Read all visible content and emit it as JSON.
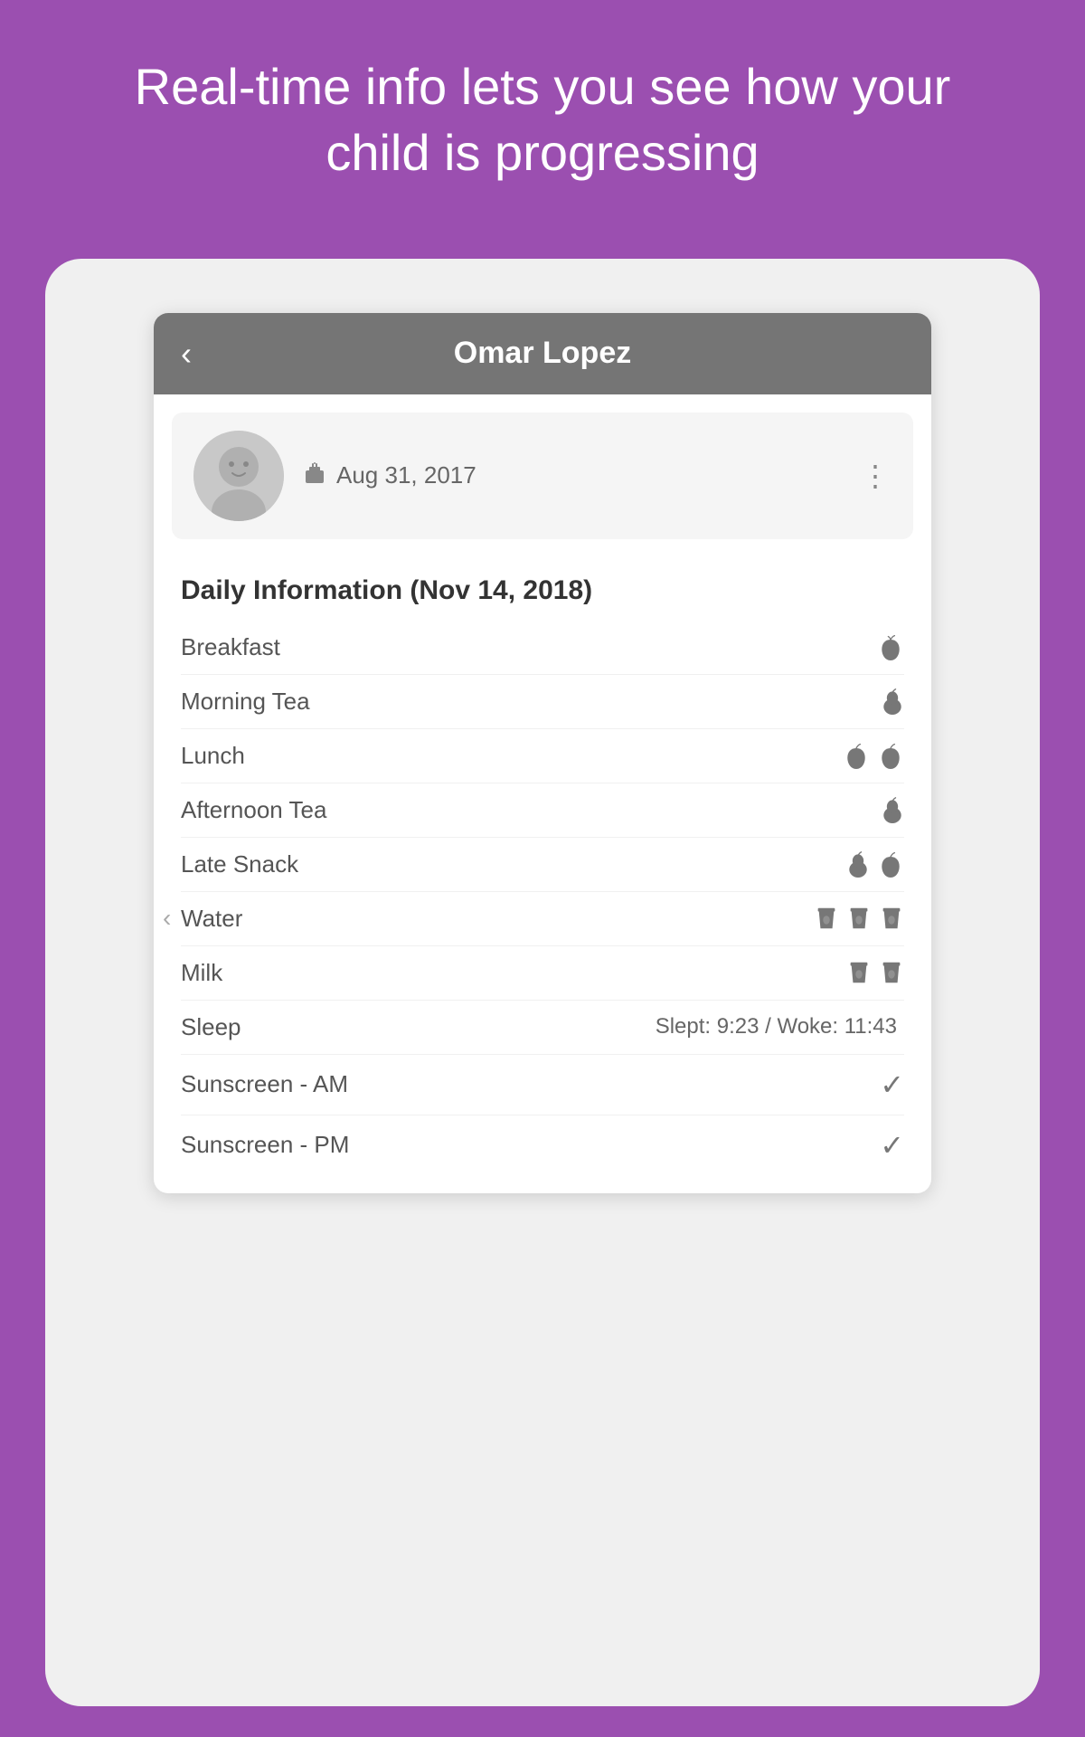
{
  "header": {
    "text": "Real-time info lets you see how your child is progressing"
  },
  "nav": {
    "back_label": "‹",
    "title": "Omar Lopez"
  },
  "profile": {
    "date": "Aug 31, 2017",
    "more_icon": "⋮"
  },
  "daily": {
    "title": "Daily Information (Nov 14, 2018)",
    "rows": [
      {
        "label": "Breakfast",
        "icons": "apple",
        "count": 1
      },
      {
        "label": "Morning Tea",
        "icons": "pear",
        "count": 1
      },
      {
        "label": "Lunch",
        "icons": "apple",
        "count": 2
      },
      {
        "label": "Afternoon Tea",
        "icons": "pear",
        "count": 1
      },
      {
        "label": "Late Snack",
        "icons": "pear-apple",
        "count": 2
      },
      {
        "label": "Water",
        "icons": "water",
        "count": 3
      },
      {
        "label": "Milk",
        "icons": "water",
        "count": 2
      },
      {
        "label": "Sleep",
        "detail": "Slept: 9:23 / Woke: 11:43",
        "icons": "none",
        "count": 0
      },
      {
        "label": "Sunscreen - AM",
        "icons": "check",
        "count": 1
      },
      {
        "label": "Sunscreen - PM",
        "icons": "check",
        "count": 1
      }
    ]
  },
  "colors": {
    "purple": "#9b4fb0",
    "nav_gray": "#757575",
    "icon_gray": "#777777"
  }
}
